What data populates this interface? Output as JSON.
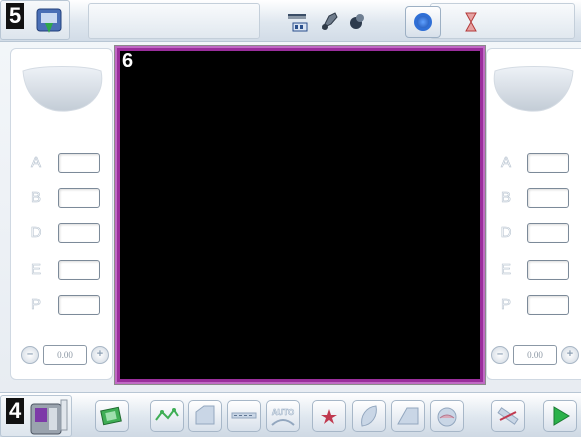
{
  "top_toolbar": {
    "mode_tile_number": "5",
    "icons": [
      "ruler-icon",
      "brush-icon",
      "drop-icon",
      "radio-target-icon",
      "hourglass-icon"
    ]
  },
  "view": {
    "number": "6"
  },
  "left_panel": {
    "rows": [
      {
        "letter": "A",
        "value": ""
      },
      {
        "letter": "B",
        "value": ""
      },
      {
        "letter": "D",
        "value": ""
      },
      {
        "letter": "E",
        "value": ""
      },
      {
        "letter": "P",
        "value": ""
      }
    ],
    "stepper_value": "0.00"
  },
  "right_panel": {
    "rows": [
      {
        "letter": "A",
        "value": ""
      },
      {
        "letter": "B",
        "value": ""
      },
      {
        "letter": "D",
        "value": ""
      },
      {
        "letter": "E",
        "value": ""
      },
      {
        "letter": "P",
        "value": ""
      }
    ],
    "stepper_value": "0.00"
  },
  "bottom_toolbar": {
    "mode_tile_number": "4",
    "auto_label": "AUTO"
  },
  "colors": {
    "view_border": "#9a2e9c",
    "accent_blue": "#2f6fd6",
    "play_green": "#2bb24a"
  }
}
